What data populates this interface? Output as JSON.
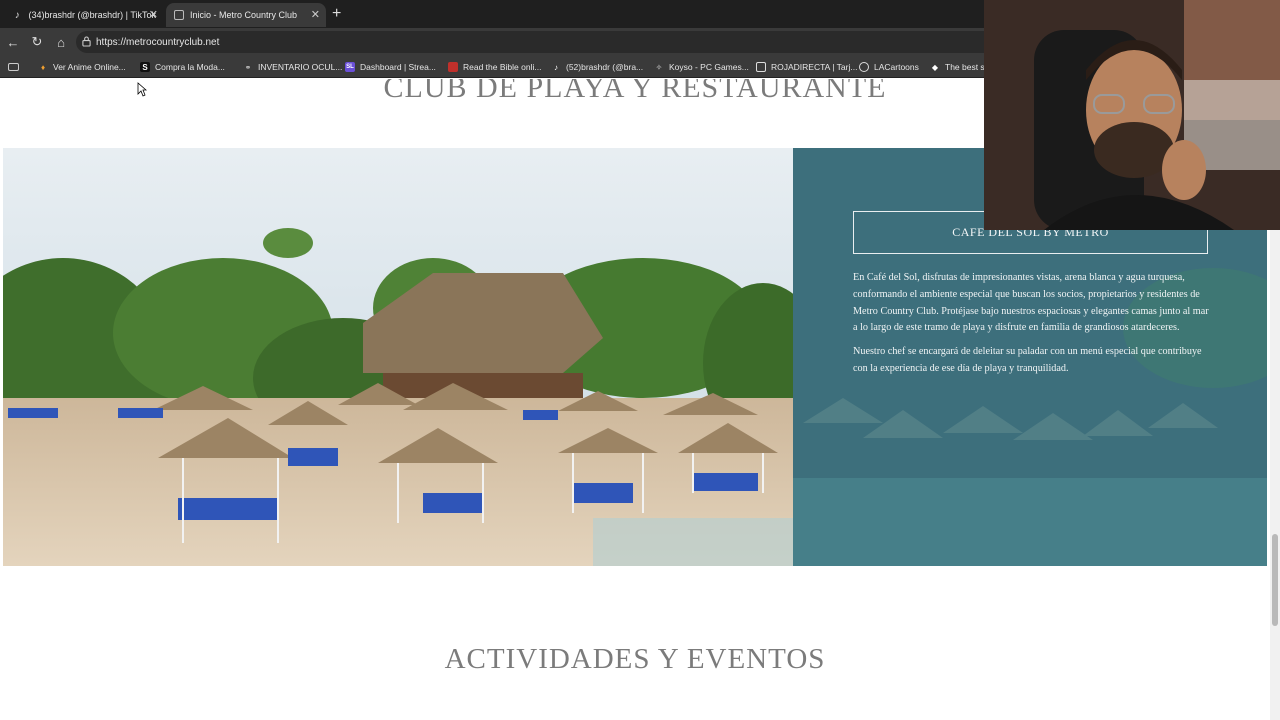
{
  "browser": {
    "tabs": [
      {
        "title": "(34)brashdr (@brashdr) | TikTok",
        "active": false
      },
      {
        "title": "Inicio - Metro Country Club",
        "active": true
      }
    ],
    "new_tab": "+",
    "url": "https://metrocountryclub.net",
    "bookmarks": [
      {
        "label": "Ver Anime Online...",
        "icon": "flame-icon"
      },
      {
        "label": "Compra la Moda...",
        "icon": "s-icon"
      },
      {
        "label": "INVENTARIO OCUL...",
        "icon": "link-icon"
      },
      {
        "label": "Dashboard | Strea...",
        "icon": "sl-icon"
      },
      {
        "label": "Read the Bible onli...",
        "icon": "bible-icon"
      },
      {
        "label": "(52)brashdr (@bra...",
        "icon": "tiktok-icon"
      },
      {
        "label": "Koyso - PC Games...",
        "icon": "sparkle-icon"
      },
      {
        "label": "ROJADIRECTA | Tarj...",
        "icon": "tv-icon"
      },
      {
        "label": "LACartoons",
        "icon": "globe-icon"
      },
      {
        "label": "The best st",
        "icon": "diamond-icon"
      }
    ]
  },
  "page": {
    "section1_title": "CLUB DE PLAYA Y RESTAURANTE",
    "panel": {
      "button_label": "CAFE DEL SOL BY METRO",
      "paragraph1": "En Café del Sol, disfrutas de impresionantes vistas, arena blanca y agua turquesa, conformando el ambiente especial que buscan los socios, propietarios y residentes de Metro Country Club. Protéjase bajo nuestros espaciosas y elegantes camas junto al mar a lo largo de este tramo de playa y disfrute en familia de grandiosos atardeceres.",
      "paragraph2": "Nuestro chef se encargará de deleitar su paladar con un menú especial que contribuye con la experiencia de ese día de playa y tranquilidad."
    },
    "section2_title": "ACTIVIDADES Y EVENTOS"
  },
  "colors": {
    "panel_teal": "#3d6f7c",
    "title_gray": "#7b7b7b",
    "chrome_dark": "#1f1f1f",
    "chrome_mid": "#3a3a3a"
  }
}
